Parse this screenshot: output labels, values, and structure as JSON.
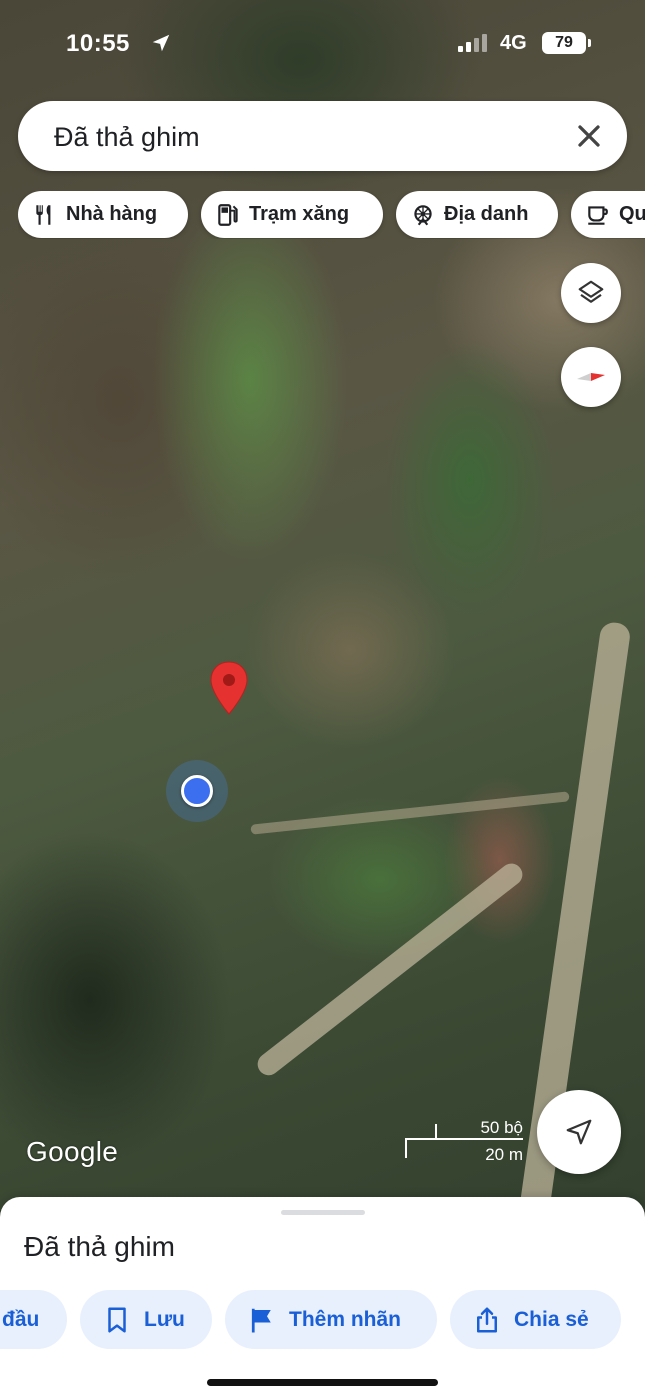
{
  "status_bar": {
    "time": "10:55",
    "network": "4G",
    "battery": "79"
  },
  "search": {
    "query": "Đã thả ghim"
  },
  "categories": [
    {
      "label": "Nhà hàng",
      "icon": "restaurant-icon"
    },
    {
      "label": "Trạm xăng",
      "icon": "gas-station-icon"
    },
    {
      "label": "Địa danh",
      "icon": "landmark-icon"
    },
    {
      "label": "Qu",
      "icon": "coffee-icon"
    }
  ],
  "map": {
    "logo": "Google",
    "scale": {
      "imperial": "50 bộ",
      "metric": "20 m"
    },
    "pin_color": "#e5312f",
    "location_dot_color": "#3b6ff0"
  },
  "sheet": {
    "title": "Đã thả ghim",
    "actions": [
      {
        "label": "đầu",
        "icon": "directions-icon"
      },
      {
        "label": "Lưu",
        "icon": "bookmark-icon"
      },
      {
        "label": "Thêm nhãn",
        "icon": "flag-icon"
      },
      {
        "label": "Chia sẻ",
        "icon": "share-icon"
      }
    ]
  },
  "colors": {
    "accent": "#1a5fd6",
    "action_bg": "#e8f0fe"
  }
}
